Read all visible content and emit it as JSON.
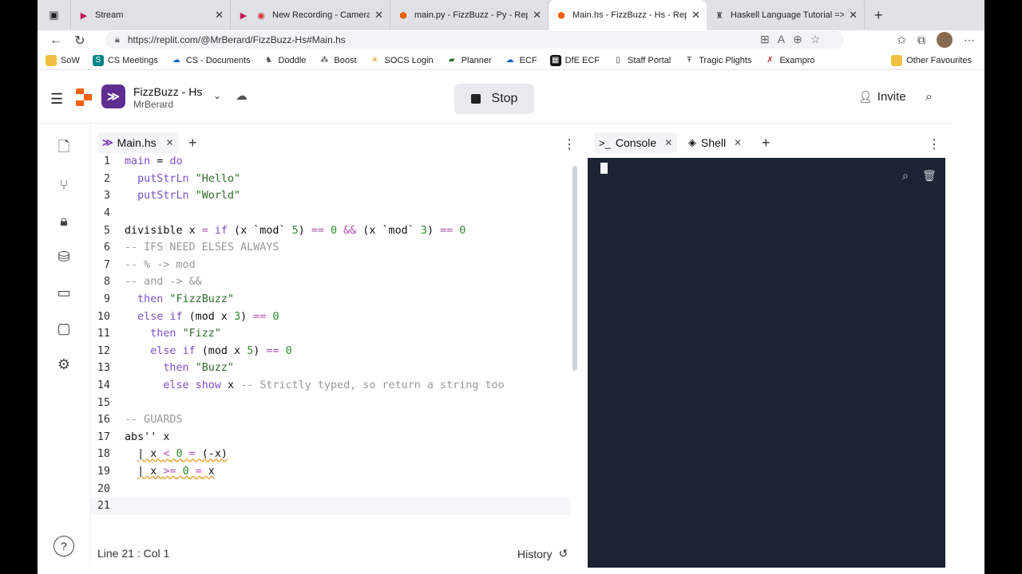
{
  "browser": {
    "tabs": [
      {
        "title": "Stream",
        "icon": "stream-icon",
        "active": false
      },
      {
        "title": "New Recording - Camera",
        "icon": "record-icon",
        "active": false
      },
      {
        "title": "main.py - FizzBuzz - Py - Repl",
        "icon": "replit-icon",
        "active": false
      },
      {
        "title": "Main.hs - FizzBuzz - Hs - Repl",
        "icon": "replit-icon",
        "active": true
      },
      {
        "title": "Haskell Language Tutorial => G",
        "icon": "tutorial-icon",
        "active": false
      }
    ],
    "new_tab": "+",
    "url": "https://replit.com/@MrBerard/FizzBuzz-Hs#Main.hs",
    "bookmarks": [
      "SoW",
      "CS Meetings",
      "CS - Documents",
      "Doddle",
      "Boost",
      "SOCS Login",
      "Planner",
      "ECF",
      "DfE ECF",
      "Staff Portal",
      "Tragic Plights",
      "Exampro"
    ],
    "other_favourites": "Other Favourites"
  },
  "header": {
    "repl_name": "FizzBuzz - Hs",
    "owner": "MrBerard",
    "lang_icon_text": "≫",
    "stop_label": "Stop",
    "invite_label": "Invite"
  },
  "editor": {
    "tab_label": "Main.hs",
    "lines": [
      {
        "n": "1",
        "html": "<span class=\"k\">main</span> = <span class=\"k\">do</span>"
      },
      {
        "n": "2",
        "html": "  <span class=\"k\">putStrLn</span> <span class=\"s\">\"Hello\"</span>"
      },
      {
        "n": "3",
        "html": "  <span class=\"k\">putStrLn</span> <span class=\"s\">\"World\"</span>"
      },
      {
        "n": "4",
        "html": ""
      },
      {
        "n": "5",
        "html": "divisible x <span class=\"op\">=</span> <span class=\"k\">if</span> (x `mod` <span class=\"n\">5</span>) <span class=\"op\">==</span> <span class=\"n\">0</span> <span class=\"op\">&amp;&amp;</span> (x `mod` <span class=\"n\">3</span>) <span class=\"op\">==</span> <span class=\"n\">0</span>"
      },
      {
        "n": "6",
        "html": "<span class=\"c\">-- IFS NEED ELSES ALWAYS</span>"
      },
      {
        "n": "7",
        "html": "<span class=\"c\">-- % -&gt; mod</span>"
      },
      {
        "n": "8",
        "html": "<span class=\"c\">-- and -&gt; &amp;&amp;</span>"
      },
      {
        "n": "9",
        "html": "  <span class=\"k\">then</span> <span class=\"s\">\"FizzBuzz\"</span>"
      },
      {
        "n": "10",
        "html": "  <span class=\"k\">else</span> <span class=\"k\">if</span> (mod x <span class=\"n\">3</span>) <span class=\"op\">==</span> <span class=\"n\">0</span>"
      },
      {
        "n": "11",
        "html": "    <span class=\"k\">then</span> <span class=\"s\">\"Fizz\"</span>"
      },
      {
        "n": "12",
        "html": "    <span class=\"k\">else</span> <span class=\"k\">if</span> (mod x <span class=\"n\">5</span>) <span class=\"op\">==</span> <span class=\"n\">0</span>"
      },
      {
        "n": "13",
        "html": "      <span class=\"k\">then</span> <span class=\"s\">\"Buzz\"</span>"
      },
      {
        "n": "14",
        "html": "      <span class=\"k\">else</span> <span class=\"k\">show</span> x <span class=\"c\">-- Strictly typed, so return a string too</span>"
      },
      {
        "n": "15",
        "html": ""
      },
      {
        "n": "16",
        "html": "<span class=\"c\">-- GUARDS</span>"
      },
      {
        "n": "17",
        "html": "abs'' x"
      },
      {
        "n": "18",
        "html": "  <span class=\"sq\">| x <span class=\"op\">&lt;</span> <span class=\"n\">0</span> <span class=\"op\">=</span> (-x)</span>"
      },
      {
        "n": "19",
        "html": "  <span class=\"sq\">| x <span class=\"op\">&gt;=</span> <span class=\"n\">0</span> <span class=\"op\">=</span> x</span>"
      },
      {
        "n": "20",
        "html": ""
      },
      {
        "n": "21",
        "html": ""
      }
    ],
    "status": "Line 21 : Col 1",
    "history_label": "History"
  },
  "console": {
    "tabs": [
      {
        "label": "Console",
        "icon": "terminal-icon"
      },
      {
        "label": "Shell",
        "icon": "shell-icon"
      }
    ]
  }
}
